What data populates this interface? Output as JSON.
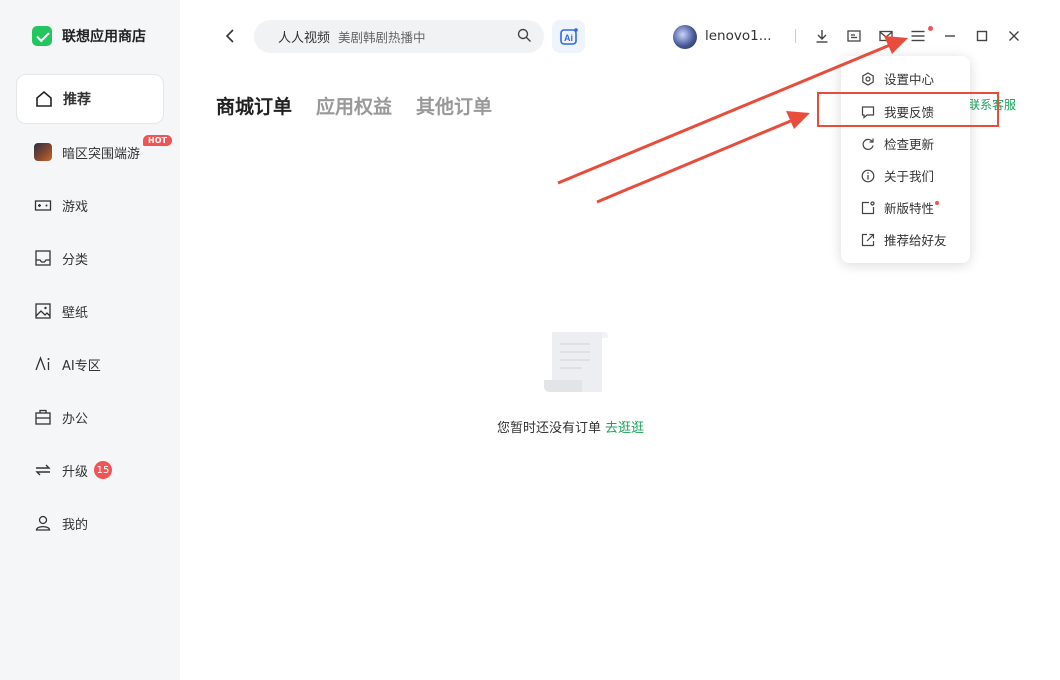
{
  "app": {
    "title": "联想应用商店"
  },
  "sidebar": {
    "items": [
      {
        "label": "推荐",
        "icon": "home-icon"
      },
      {
        "label": "暗区突围端游",
        "icon": "game-thumbnail",
        "badge": "HOT"
      },
      {
        "label": "游戏",
        "icon": "gamepad-icon"
      },
      {
        "label": "分类",
        "icon": "tray-icon"
      },
      {
        "label": "壁纸",
        "icon": "image-icon"
      },
      {
        "label": "AI专区",
        "icon": "ai-icon"
      },
      {
        "label": "办公",
        "icon": "briefcase-icon"
      },
      {
        "label": "升级",
        "icon": "refresh-icon",
        "badge": "15"
      },
      {
        "label": "我的",
        "icon": "user-icon"
      }
    ]
  },
  "search": {
    "hot": "人人视频",
    "placeholder": "美剧韩剧热播中"
  },
  "user": {
    "name": "lenovo1..."
  },
  "tabs": [
    "商城订单",
    "应用权益",
    "其他订单"
  ],
  "contact": "联系客服",
  "empty": {
    "text": "您暂时还没有订单",
    "link": "去逛逛"
  },
  "menu": {
    "items": [
      {
        "label": "设置中心",
        "icon": "settings-icon"
      },
      {
        "label": "我要反馈",
        "icon": "feedback-icon"
      },
      {
        "label": "检查更新",
        "icon": "refresh-icon"
      },
      {
        "label": "关于我们",
        "icon": "info-icon"
      },
      {
        "label": "新版特性",
        "icon": "new-feature-icon"
      },
      {
        "label": "推荐给好友",
        "icon": "share-icon"
      }
    ]
  },
  "colors": {
    "accent": "#1aa35a",
    "badge": "#f05454",
    "annotation": "#e74c3c"
  }
}
